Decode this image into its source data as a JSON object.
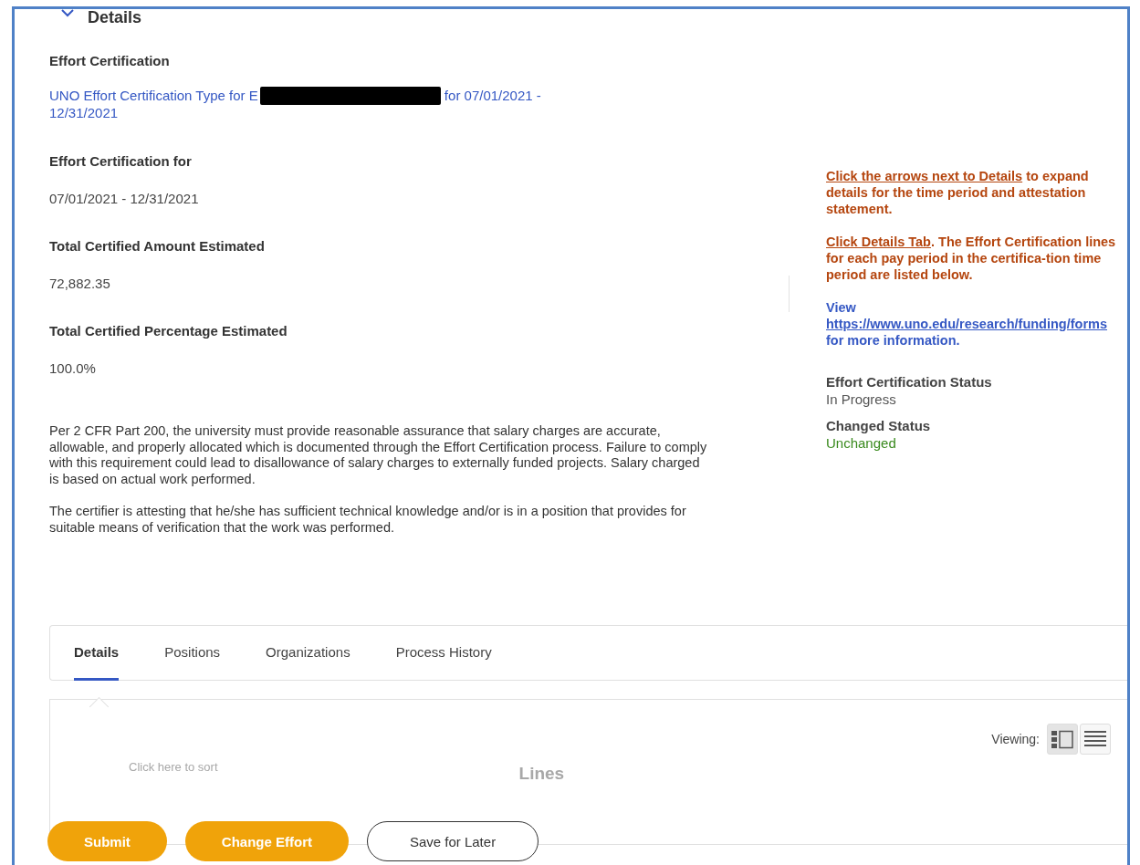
{
  "section": {
    "title": "Details",
    "expanded": true
  },
  "fields": [
    {
      "label": "Effort Certification",
      "value_parts": [
        "UNO Effort Certification Type for E",
        "for 07/01/2021 - 12/31/2021"
      ],
      "kind": "link"
    },
    {
      "label": "Effort Certification for",
      "value": "07/01/2021 - 12/31/2021",
      "kind": "text"
    },
    {
      "label": "Total Certified Amount Estimated",
      "value": "72,882.35",
      "kind": "text"
    },
    {
      "label": "Total Certified Percentage Estimated",
      "value": "100.0%",
      "kind": "text"
    }
  ],
  "statement": [
    "Per 2 CFR Part 200, the university must provide reasonable assurance that salary charges are accurate, allowable, and properly allocated which is documented through the Effort Certification process. Failure to comply with this requirement could lead to disallowance of salary charges to externally funded projects. Salary charged is based on actual work performed.",
    "The certifier is attesting that he/she has sufficient technical knowledge and/or is in a position that provides for suitable means of verification that the work was performed."
  ],
  "instructions": [
    {
      "color": "#b5460f",
      "parts": [
        {
          "text": "Click the arrows next to Details",
          "link": true
        },
        {
          "text": " to expand details for the time period and attestation statement.",
          "link": false
        }
      ]
    },
    {
      "color": "#b5460f",
      "parts": [
        {
          "text": "Click Details Tab",
          "link": true
        },
        {
          "text": ". The Effort Certification lines for each pay period in the certifica-tion time period are listed below.",
          "link": false
        }
      ]
    },
    {
      "color": "#3558c4",
      "parts": [
        {
          "text": "View ",
          "link": false
        },
        {
          "text": "https://www.uno.edu/research/funding/forms",
          "link": true
        },
        {
          "text": " for more information.",
          "link": false
        }
      ]
    }
  ],
  "status": [
    {
      "label": "Effort Certification Status",
      "value": "In Progress",
      "color": "#555555"
    },
    {
      "label": "Changed Status",
      "value": "Unchanged",
      "color": "#3a8a1e"
    }
  ],
  "tabs": [
    {
      "label": "Details",
      "selected": true
    },
    {
      "label": "Positions",
      "selected": false
    },
    {
      "label": "Organizations",
      "selected": false
    },
    {
      "label": "Process History",
      "selected": false
    }
  ],
  "viewing": {
    "label": "Viewing:",
    "modes": [
      {
        "kind": "split",
        "selected": true
      },
      {
        "kind": "list",
        "selected": false
      }
    ]
  },
  "behind_footer": {
    "sort_hint": "Click here to sort",
    "heading": "Lines"
  },
  "buttons": [
    {
      "label": "Submit",
      "kind": "primary"
    },
    {
      "label": "Change Effort",
      "kind": "primary"
    },
    {
      "label": "Save for Later",
      "kind": "secondary"
    }
  ]
}
